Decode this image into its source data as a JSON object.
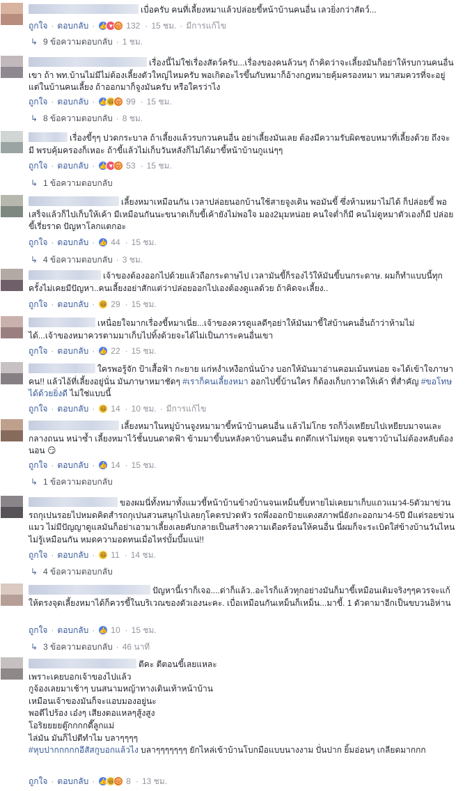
{
  "labels": {
    "like": "ถูกใจ",
    "reply": "ตอบกลับ",
    "dot": "·",
    "edited": "มีการแก้ไข"
  },
  "comments": [
    {
      "text": "เบื่อครับ คนที่เลี้ยงหมาแล้วปล่อยขี้หน้าบ้านคนอื่น เลวยิ่งกว่าสัตว์...",
      "reactions": [
        "like",
        "love",
        "angry"
      ],
      "count": "132",
      "time": "15 ชม.",
      "edited": true,
      "replies": "9 ข้อความตอบกลับ",
      "replies_time": "1 ชม."
    },
    {
      "text": "เรื่องนี้ไม่ใช่เรื่องสัตว์ครับ...เรื่องของคนล้วนๆ ถ้าคิดว่าจะเลี้ยงมันก็อย่าให้รบกวนคนอื่นเขา ถ้า พท.บ้านไม่มีไม่ต้องเลี้ยงตัวใหญ่ไหมครับ พอเกิดอะไรขึ้นกับหมาก็อ้างกฎหมายคุ้มครองหมา หมาสมควรที่จะอยู่แต่ในบ้านคนเลี้ยง ถ้าออกมาก็จูงมันครับ หรือใครว่าไง",
      "reactions": [
        "like",
        "haha",
        "angry"
      ],
      "count": "99",
      "time": "15 ชม.",
      "edited": false,
      "replies": "8 ข้อความตอบกลับ",
      "replies_time": "8 ชม."
    },
    {
      "text": "เรื่องขี้ๆๆ ปวดกระบาล ถ้าเลี้ยงแล้วรบกวนคนอื่น อย่าเลี้ยงมันเลย ต้องมีความรับผิดชอบหมาที่เลี้ยงด้วย ถึงจะมี พรบคุ้มครองก็เหอะ ถ้าขี้แล้วไม่เก็บวันหลังก็ไม่ได้มาขี้หน้าบ้านกูแน่ๆๆ",
      "reactions": [
        "like",
        "love",
        "angry"
      ],
      "count": "53",
      "time": "15 ชม.",
      "edited": false,
      "replies": "1 ข้อความตอบกลับ",
      "replies_time": ""
    },
    {
      "text": "เลี้ยงหมาเหมือนกัน เวลาปล่อยนอกบ้านใช้สายจูงเดิน พอมันขี้ ซึ่งห้ามหมาไม่ได้ ก็ปล่อยขี้ พอเสร็จแล้วก็ไปเก็บให้เค้า มีเหมือนกันนะขนาดเก็บขี้เค้ายังไม่พอใจ มอง2มุมหน่อย คนใจต่ำก็มี คนไม่ดูหมาตัวเองก็มี ปล่อยขี้เรี่ยราด ปัญหาโลกแตกอะ",
      "reactions": [
        "like"
      ],
      "count": "44",
      "time": "15 ชม.",
      "edited": false,
      "replies": "4 ข้อความตอบกลับ",
      "replies_time": "3 ชม."
    },
    {
      "text": "เจ้าของต้องออกไปด้วยแล้วถือกระดาษไป เวลามันขี้ก็รองไว้ให้มันขี้บนกระดาษ. ผมก็ทำแบบนี้ทุกครั้งไม่เคยมีปัญหา..คนเลี้ยงอย่าสักแต่ว่าปล่อยออกไปเองต้องดูแลด้วย ถ้าคิดจะเลี้ยง..",
      "reactions": [
        "haha"
      ],
      "count": "29",
      "time": "15 ชม.",
      "edited": false,
      "replies": "",
      "replies_time": ""
    },
    {
      "text": "เหนื่อยใจมากเรื่องขี้หมาเนี่ย...เจ้าของควรดูแลดีๆอย่าให้มันมาขี้ใส่บ้านคนอื่นถ้าว่าห้ามไม่ได้...เจ้าของหมาควรตามมาเก็บไปทิ้งด้วยจะได้ไม่เป็นภาระคนอื่นเขา",
      "reactions": [
        "like"
      ],
      "count": "22",
      "time": "15 ชม.",
      "edited": false,
      "replies": "",
      "replies_time": ""
    },
    {
      "text": "ใครพอรู้จัก ป้าเสื้อฟ้า กะยาย แก่หงำเหงือกนั่นบ้าง บอกให้มันมาอ่านคอมเม้นหน่อย จะได้เข้าใจภาษาคน!! แล้วไอ้ที่เลี้ยงอยู่นั่น มันภาษาหมาชัดๆ ",
      "tag1": "#เราก็คนเลี้ยงหมา",
      "text2": " ออกไปขี้บ้านใคร ก็ต้องเก็บกวาดให้เค้า ที่สำคัญ ",
      "tag2": "#ขอโทษได้ด้วยยิ่งดี",
      "text3": " ไม่ใช่แบบนี้",
      "reactions": [
        "haha"
      ],
      "count": "14",
      "time": "10 ชม.",
      "edited": true,
      "replies": "",
      "replies_time": ""
    },
    {
      "text": "เลี้ยงหมาในหมู่บ้านจูงหมามาขี้หน้าบ้านคนอื่น แล้วไม่โกย รถก็วิ่งเหยียบไปเหยียบมาจนเละกลางถนน หน่าซ้ำ เลี้ยงหมาไว้ชั้นบนดาดฟ้า ข้ามมาขี้บนหลังคาบ้านคนอื่น ตกตึกเห่าไม่หยุด จนชาวบ้านไม่ต้องหลับต้องนอน 😏",
      "reactions": [
        "like"
      ],
      "count": "14",
      "time": "15 ชม.",
      "edited": false,
      "replies": "1 ข้อความตอบกลับ",
      "replies_time": ""
    },
    {
      "text": "ของผมนี่ทั้งหมาทั้งแมวขี้หน้าบ้านข้างบ้านจนเหม็นขี้บหายไม่เคยมาเก็บแถวแมว4-5ตัวมาข่วนรถกุเปนรอยไปหมดคิดสำรถกุเปนสวนสนุกไปเลยกุโคตรปวดหัว รถพึ่งออกป้ายแดงสภาพนี่ยังกะออกมา4-5ปี มีแต่รอยข่วนแมว ไม่มีปัญญาดูแลมันก็อย่าเอามาเลี้ยงเลยคับกลายเป็นสร้างความเดือดร้อนให้คนอื่น นี่ผมก็จะระเบิดใส่ข้างบ้านวันไหนไม่รู้เหมือนกัน หมดความอดทนเมื่อไหร่บั้มบึ้มแน่!!",
      "reactions": [
        "haha"
      ],
      "count": "11",
      "time": "14 ชม.",
      "edited": false,
      "replies": "4 ข้อความตอบกลับ",
      "replies_time": ""
    },
    {
      "text": "ปัญหานี้เราก็เจอ....ด่าก็แล้ว..อะไรก็แล้วทุกอย่างมันก็มาขี้เหมือนเดิมจริงๆๆควรจะแก้ให้ตรงจุดเลี้ยงหมาได้ก็ควรขี้ในบริเวณของตัวเองนะคะ. เบื่อเหมือนกันเหม็นก็เหม็น...มาขี้. 1 ตัวตามาอีกเป็นขบวนอิห่าน",
      "reactions": [
        "like"
      ],
      "count": "10",
      "time": "15 ชม.",
      "edited": false,
      "replies": "3 ข้อความตอบกลับ",
      "replies_time": "46 นาที"
    },
    {
      "name_suffix": "ตีคะ ตีตอนขี้เลยแหละ",
      "lines": [
        "เพราะเคยบอกเจ้าของไปแล้ว",
        "กูจ้องเลยมาเช้าๆ บนสนามหญ้าทางเดินเท้าหน้าบ้าน",
        "เหมือนเจ้าของมันก็จะแอบมองอยู่นะ",
        "พอตีไปร้อง เอ๋งๆ เสียงตอแหลๆสู้งสูง",
        "โอริยยยยตู๊กกกกดี๊ลูกแม่",
        "ไล่มัน มันก็ไปตีทำไม บลาๆๆๆๆ"
      ],
      "tag": "#หุบปากกกกกอีสัสกูบอกแล้วไง",
      "tail": " บลาๆๆๆๆๆๆๆ ยักไหล่เข้าบ้านโบกมือแบบนางงาม ปั่นปาก ยิ้มอ่อนๆ เกลียดมากกก",
      "reactions": [
        "like",
        "haha",
        "angry"
      ],
      "count": "8",
      "time": "13 ชม.",
      "edited": false,
      "replies": "",
      "replies_time": ""
    }
  ]
}
